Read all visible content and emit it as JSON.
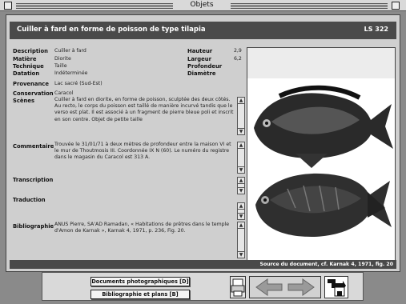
{
  "window": {
    "title": "Objets"
  },
  "header": {
    "title": "Cuiller à fard en forme de poisson de type tilapia",
    "code": "LS 322"
  },
  "fields": {
    "description": {
      "label": "Description",
      "value": "Cuiller à fard"
    },
    "matiere": {
      "label": "Matière",
      "value": "Diorite"
    },
    "technique": {
      "label": "Technique",
      "value": "Taille"
    },
    "datation": {
      "label": "Datation",
      "value": "Indéterminée"
    },
    "provenance": {
      "label": "Provenance",
      "value": "Lac sacré (Sud-Est)"
    },
    "conservation": {
      "label": "Conservation",
      "value": "Caracol"
    },
    "scenes": {
      "label": "Scènes",
      "value": "Cuiller à fard en diorite, en forme de poisson, sculptée des deux côtés. Au recto, le corps du poisson est taillé de manière incurvé tandis que le verso est plat. Il est associé à un fragment de pierre bleue poli et inscrit en son centre. Objet de petite taille"
    },
    "commentaire": {
      "label": "Commentaire",
      "value": "Trouvée le 31/01/71 à deux mètres de profondeur entre la maison VI et le mur de Thoutmosis III. Coordonnée IX N (60). Le numéro du registre dans le magasin du Caracol est 313 A."
    },
    "transcription": {
      "label": "Transcription",
      "value": ""
    },
    "traduction": {
      "label": "Traduction",
      "value": ""
    },
    "bibliographie": {
      "label": "Bibliographie",
      "value": "ANUS Pierre, SA'AD Ramadan, « Habitations de prêtres dans le temple d'Amon de Karnak », Karnak 4, 1971, p. 236, Fig. 20."
    }
  },
  "dimensions": {
    "hauteur": {
      "label": "Hauteur",
      "value": "2,9"
    },
    "largeur": {
      "label": "Largeur",
      "value": "6,2"
    },
    "profondeur": {
      "label": "Profondeur",
      "value": ""
    },
    "diametre": {
      "label": "Diamètre",
      "value": ""
    }
  },
  "image_caption": "Source du document, cf. Karnak 4, 1971, fig. 20",
  "buttons": {
    "photos": "Documents photographiques [D]",
    "biblio": "Bibliographie et plans [B]"
  },
  "icons": [
    "printer-icon",
    "previous-arrow-icon",
    "next-arrow-icon",
    "save-disk-icon"
  ],
  "colors": {
    "panel": "#cfcfcf",
    "header": "#4a4a4a",
    "background": "#8a8a8a"
  }
}
